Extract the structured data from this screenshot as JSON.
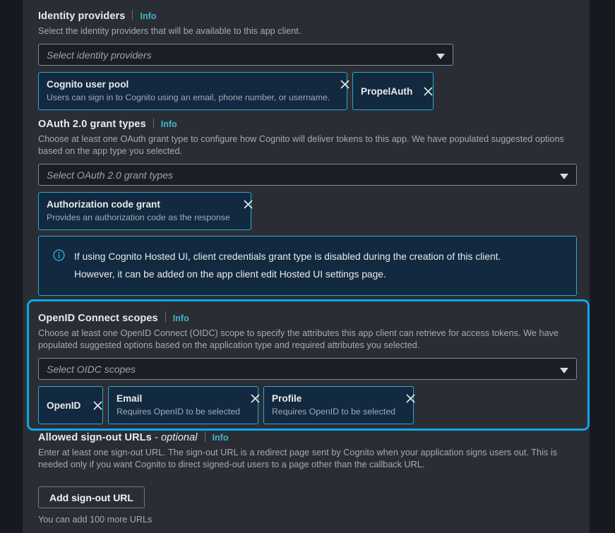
{
  "sections": {
    "identity_providers": {
      "label": "Identity providers",
      "info": "Info",
      "description": "Select the identity providers that will be available to this app client.",
      "select_placeholder": "Select identity providers",
      "chips": [
        {
          "title": "Cognito user pool",
          "subtitle": "Users can sign in to Cognito using an email, phone number, or username.",
          "remove": "remove"
        },
        {
          "title": "PropelAuth",
          "subtitle": "",
          "remove": "remove"
        }
      ]
    },
    "oauth_grant_types": {
      "label": "OAuth 2.0 grant types",
      "info": "Info",
      "description": "Choose at least one OAuth grant type to configure how Cognito will deliver tokens to this app. We have populated suggested options based on the app type you selected.",
      "select_placeholder": "Select OAuth 2.0 grant types",
      "chips": [
        {
          "title": "Authorization code grant",
          "subtitle": "Provides an authorization code as the response",
          "remove": "remove"
        }
      ]
    },
    "alert": {
      "line1": "If using Cognito Hosted UI, client credentials grant type is disabled during the creation of this client.",
      "line2": "However, it can be added on the app client edit Hosted UI settings page."
    },
    "oidc_scopes": {
      "label": "OpenID Connect scopes",
      "info": "Info",
      "description": "Choose at least one OpenID Connect (OIDC) scope to specify the attributes this app client can retrieve for access tokens. We have populated suggested options based on the application type and required attributes you selected.",
      "select_placeholder": "Select OIDC scopes",
      "chips": [
        {
          "title": "OpenID",
          "subtitle": "",
          "remove": "remove"
        },
        {
          "title": "Email",
          "subtitle": "Requires OpenID to be selected",
          "remove": "remove"
        },
        {
          "title": "Profile",
          "subtitle": "Requires OpenID to be selected",
          "remove": "remove"
        }
      ]
    },
    "signout_urls": {
      "label": "Allowed sign-out URLs",
      "optional": " - optional",
      "info": "Info",
      "description": "Enter at least one sign-out URL. The sign-out URL is a redirect page sent by Cognito when your application signs users out. This is needed only if you want Cognito to direct signed-out users to a page other than the callback URL.",
      "button_label": "Add sign-out URL",
      "hint": "You can add 100 more URLs"
    }
  },
  "colors": {
    "accent": "#0fa6e9",
    "chip_border": "#2ea6d6",
    "chip_fill": "#12293f",
    "info_link": "#42b4ce",
    "panel_bg": "#2a2e34",
    "page_bg": "#16191f"
  }
}
